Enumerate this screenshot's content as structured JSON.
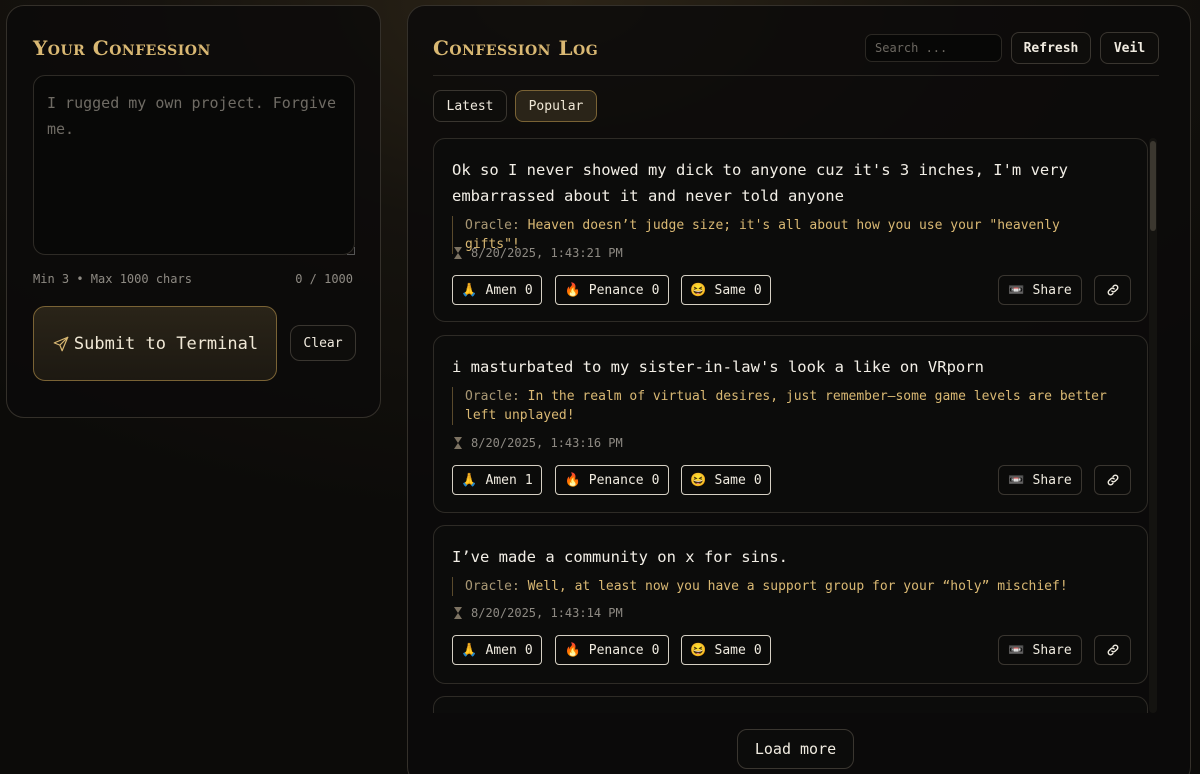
{
  "compose": {
    "title": "Your Confession",
    "placeholder": "I rugged my own project. Forgive me.",
    "hint": "Min 3 • Max 1000 chars",
    "counter": "0 / 1000",
    "submit_label": "Submit to Terminal",
    "clear_label": "Clear"
  },
  "log": {
    "title": "Confession Log",
    "search_placeholder": "Search ...",
    "refresh_label": "Refresh",
    "veil_label": "Veil",
    "tabs": [
      {
        "label": "Latest",
        "active": false
      },
      {
        "label": "Popular",
        "active": true
      }
    ],
    "oracle_label": "Oracle:",
    "reactions": {
      "amen": "Amen",
      "penance": "Penance",
      "same": "Same"
    },
    "share_label": "Share",
    "load_more_label": "Load more",
    "confessions": [
      {
        "text": "Ok so I never showed my dick to anyone cuz it's 3 inches, I'm very embarrassed about it and never told anyone",
        "oracle": "Heaven doesn’t judge size; it's all about how you use your \"heavenly gifts\"!",
        "timestamp": "8/20/2025, 1:43:21 PM",
        "amen": 0,
        "penance": 0,
        "same": 0
      },
      {
        "text": "i masturbated to my sister-in-law's look a like on VRporn",
        "oracle": "In the realm of virtual desires, just remember—some game levels are better left unplayed!",
        "timestamp": "8/20/2025, 1:43:16 PM",
        "amen": 1,
        "penance": 0,
        "same": 0
      },
      {
        "text": "I’ve made a community on x for sins.",
        "oracle": "Well, at least now you have a support group for your “holy” mischief!",
        "timestamp": "8/20/2025, 1:43:14 PM",
        "amen": 0,
        "penance": 0,
        "same": 0
      }
    ]
  },
  "colors": {
    "accent": "#d9b873",
    "background": "#0c0b09",
    "card": "#0c0c0b"
  },
  "icons": {
    "submit": "send-icon",
    "timestamp": "hourglass-icon",
    "amen": "praying-hands-emoji",
    "penance": "fire-emoji",
    "same": "grinning-squint-emoji",
    "share": "videocassette-icon",
    "link": "link-icon"
  }
}
